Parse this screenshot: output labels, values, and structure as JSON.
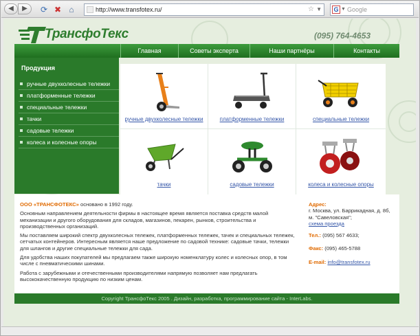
{
  "browser": {
    "url": "http://www.transfotex.ru/",
    "search_placeholder": "Google"
  },
  "site": {
    "logo_text": "ТрансфоТекс",
    "phone": "(095) 764-4653"
  },
  "topnav": [
    "Главная",
    "Советы эксперта",
    "Наши партнёры",
    "Контакты"
  ],
  "sidebar": {
    "title": "Продукция",
    "items": [
      "ручные двухколесные тележки",
      "платформенные тележки",
      "специальные тележки",
      "тачки",
      "садовые тележки",
      "колеса и колесные опоры"
    ]
  },
  "products": [
    "ручные двухколесные тележки",
    "платформенные тележки",
    "специальные тележки",
    "тачки",
    "садовые тележки",
    "колеса и колесные опоры"
  ],
  "about": {
    "brand": "ООО «ТРАНСФОТЕКС»",
    "founded": "основано в 1992 году.",
    "p1": "Основным направлением деятельности фирмы в настоящее время является поставка средств малой механизации и другого оборудования для складов, магазинов, пекарен, рынков, строительства и производственных организаций.",
    "p2": "Мы поставляем широкий спектр двухколесных тележек, платформенных тележек, тачек и специальных тележек, сетчатых контейнеров. Интересным является наше предложение по садовой технике: садовые тачки, тележки для шлангов и другие специальные тележки для сада.",
    "p3": "Для удобства наших покупателей мы предлагаем также широкую номенклатуру колес и колесных опор, в том числе с пневматическими шинами.",
    "p4": "Работа с зарубежными и отечественными производителями напрямую позволяет нам предлагать высококачественную продукцию по низким ценам."
  },
  "contacts": {
    "address_label": "Адрес:",
    "address": "г. Москва, ул. Баррикадная, д. 8б, м. \"Савеловская\";",
    "map_link": "схема проезда",
    "tel_label": "Тел.:",
    "tel": "(095) 567 4633;",
    "fax_label": "Факс:",
    "fax": "(095) 465-5788",
    "email_label": "E-mail:",
    "email": "info@transfotex.ru"
  },
  "footer": "Copyright ТрансфоТекс 2005 . Дизайн, разработка, программирование сайта - InterLabs.",
  "colors": {
    "green_dark": "#2a7a2a",
    "accent_orange": "#e06a00",
    "link_blue": "#3456a8"
  }
}
